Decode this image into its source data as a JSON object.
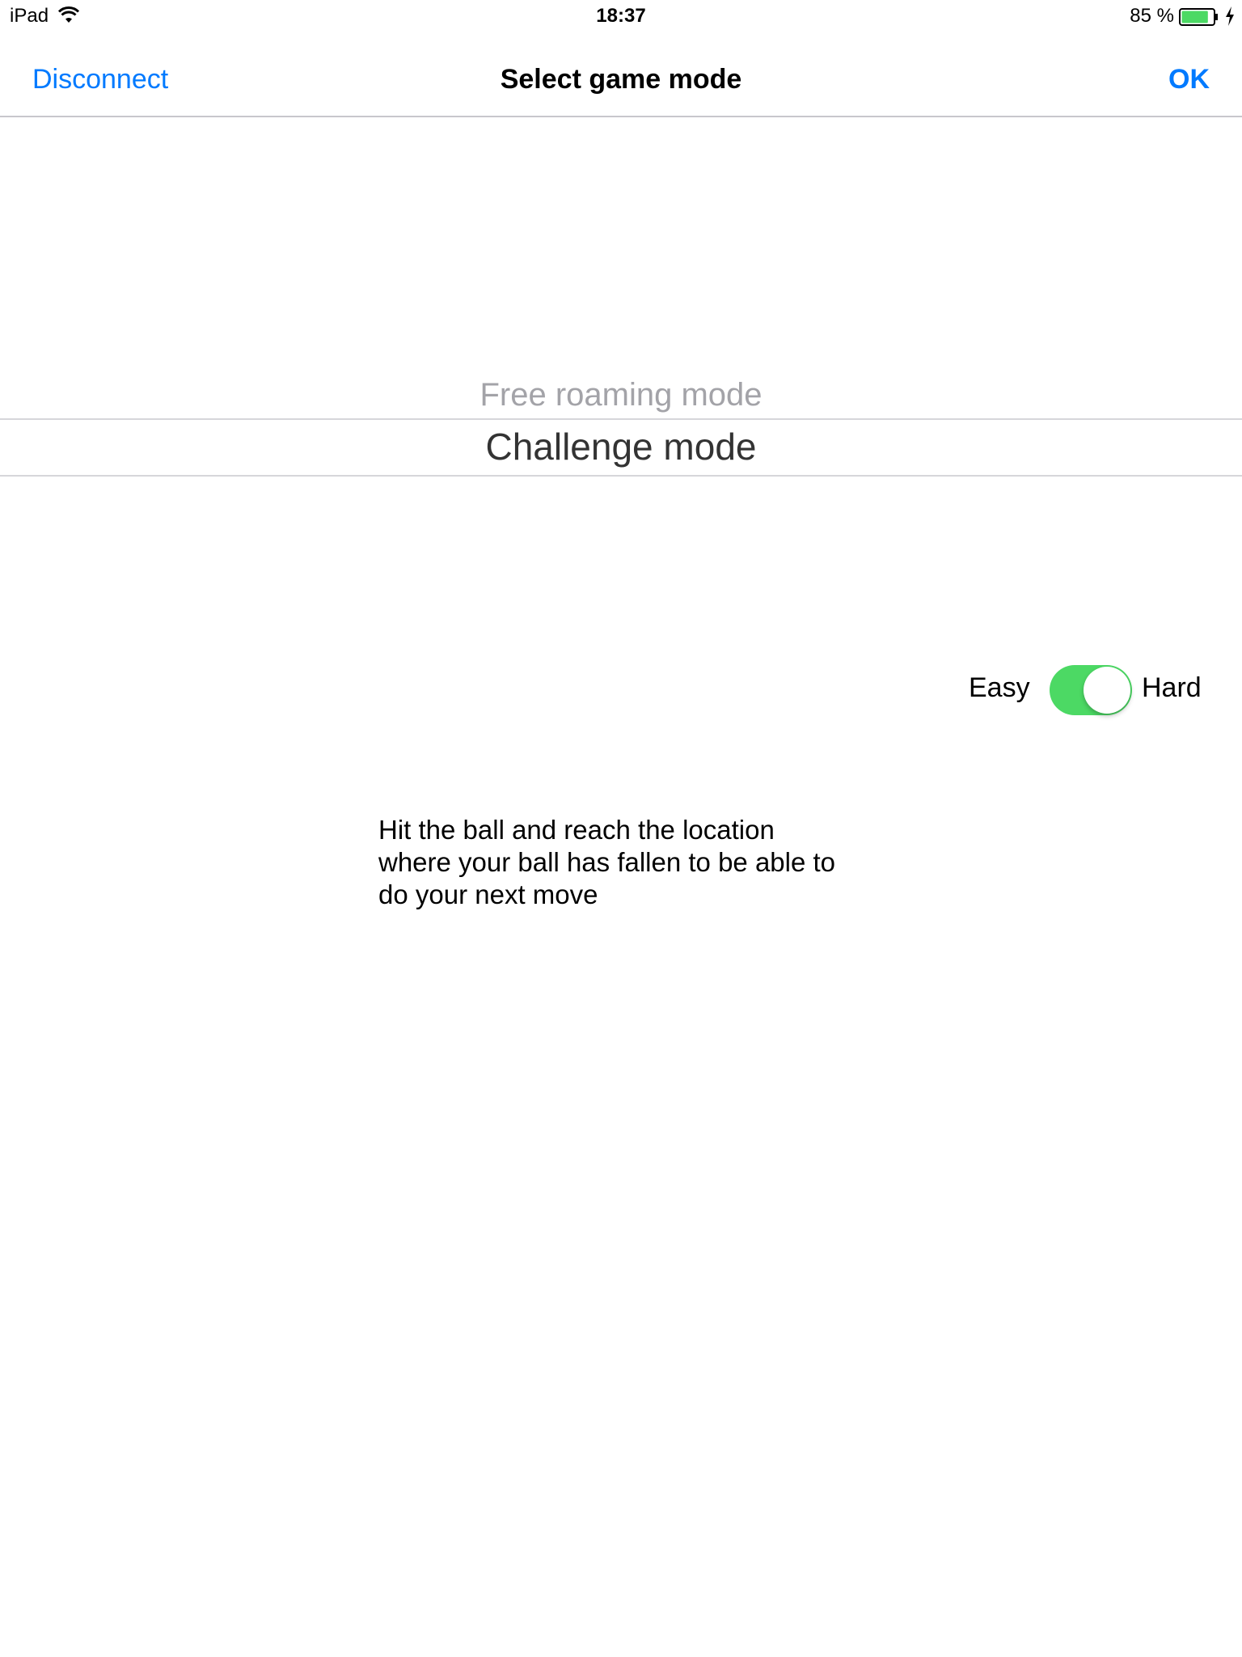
{
  "status_bar": {
    "device": "iPad",
    "wifi_icon": "wifi-icon",
    "time": "18:37",
    "battery_text": "85 %",
    "battery_icon": "battery-icon",
    "battery_level": 0.85,
    "battery_color": "#4cd964",
    "charging_icon": "charging-bolt-icon"
  },
  "nav": {
    "left_label": "Disconnect",
    "title": "Select game mode",
    "right_label": "OK",
    "accent_color": "#007aff"
  },
  "picker": {
    "options": [
      "Free roaming mode",
      "Challenge mode"
    ],
    "selected": "Challenge mode"
  },
  "difficulty": {
    "left_label": "Easy",
    "right_label": "Hard",
    "toggle_on": true,
    "toggle_color": "#4cd964"
  },
  "description": {
    "lines": [
      "Hit the ball and reach the location",
      "where your ball has fallen to be able to",
      "do your next move"
    ]
  }
}
